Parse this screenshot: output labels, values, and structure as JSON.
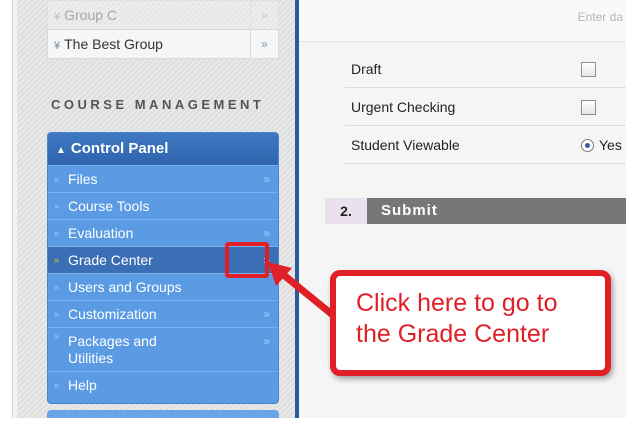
{
  "sidebar": {
    "groups": [
      {
        "label": "Group C",
        "arrow": "»"
      },
      {
        "label": "The Best Group",
        "arrow": "»"
      }
    ],
    "group_chevron": "¥",
    "section_heading": "COURSE MANAGEMENT",
    "control_panel": {
      "title": "Control Panel",
      "title_chevron": "»",
      "items": [
        {
          "label": "Files",
          "arrow": "»"
        },
        {
          "label": "Course Tools",
          "arrow": ""
        },
        {
          "label": "Evaluation",
          "arrow": "»"
        },
        {
          "label": "Grade Center",
          "arrow": "»"
        },
        {
          "label": "Users and Groups",
          "arrow": ""
        },
        {
          "label": "Customization",
          "arrow": "»"
        },
        {
          "label": "Packages and Utilities",
          "arrow": "»"
        },
        {
          "label": "Help",
          "arrow": ""
        }
      ],
      "bullet": "»"
    }
  },
  "main": {
    "enter_hint": "Enter da",
    "options": [
      {
        "label": "Draft"
      },
      {
        "label": "Urgent Checking"
      },
      {
        "label": "Student Viewable",
        "radio_label": "Yes"
      }
    ],
    "submit": {
      "number": "2.",
      "label": "Submit"
    }
  },
  "callout": {
    "text": "Click here to go to the Grade Center"
  },
  "colors": {
    "accent_red": "#e01f26",
    "panel_blue": "#5b9be4",
    "header_blue": "#2f64ad"
  }
}
